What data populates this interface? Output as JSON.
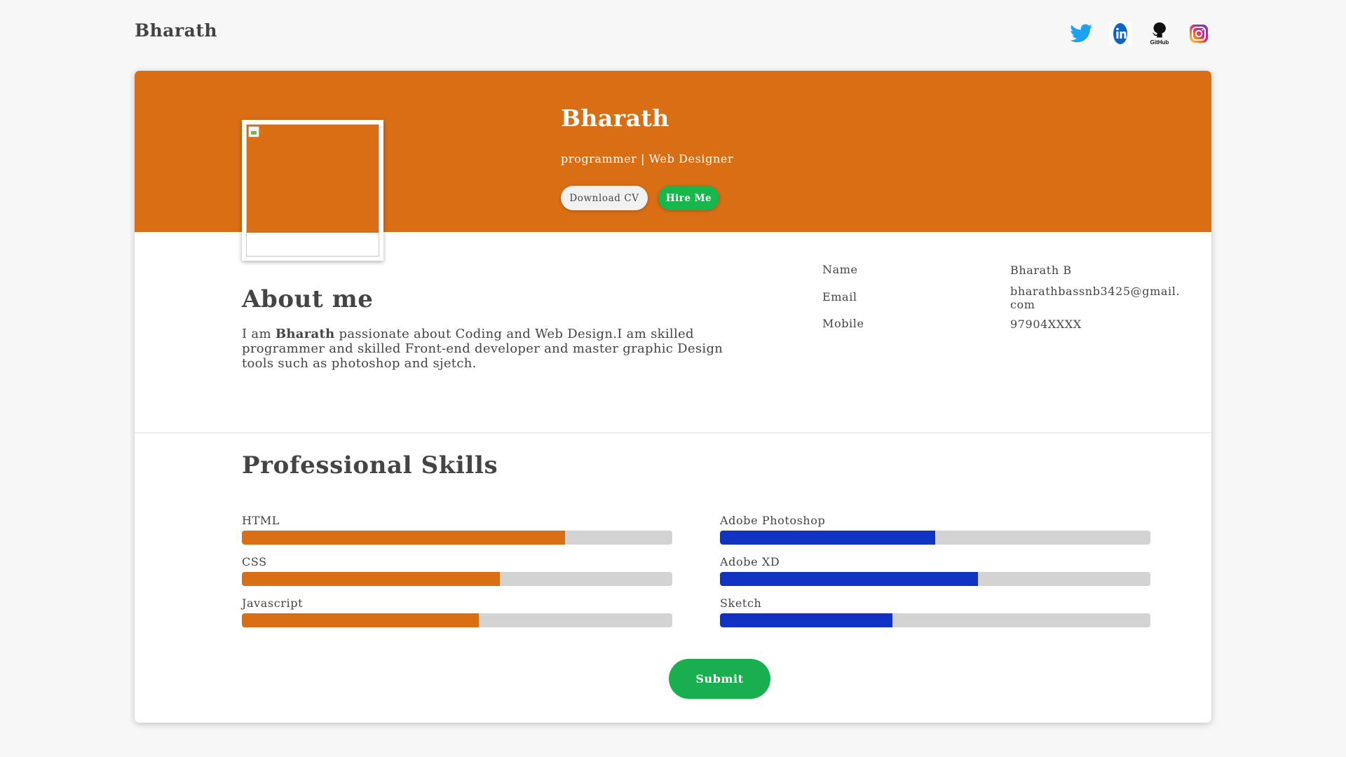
{
  "header": {
    "brand": "Bharath",
    "social": [
      {
        "name": "twitter-icon",
        "color": "#1da1f2"
      },
      {
        "name": "linkedin-icon",
        "color": "#0a66c2"
      },
      {
        "name": "github-icon",
        "color": "#111111",
        "caption": "GitHub"
      },
      {
        "name": "instagram-icon",
        "color": "#d62976"
      }
    ]
  },
  "hero": {
    "name": "Bharath",
    "role": "programmer | Web Designer",
    "download_label": "Download CV",
    "hire_label": "Hire Me",
    "accent": "#d96e15"
  },
  "about": {
    "title": "About me",
    "text_prefix": "I am ",
    "text_bold": "Bharath",
    "text_suffix": " passionate about Coding and Web Design.I am skilled programmer and skilled Front-end developer and master graphic Design tools such as photoshop and sjetch.",
    "info": [
      {
        "label": "Name",
        "value": "Bharath B"
      },
      {
        "label": "Email",
        "value": "bharathbassnb3425@gmail.com"
      },
      {
        "label": "Mobile",
        "value": "97904XXXX"
      }
    ]
  },
  "skills": {
    "title": "Professional Skills",
    "left": [
      {
        "label": "HTML",
        "percent": 75,
        "color": "#d96e15"
      },
      {
        "label": "CSS",
        "percent": 60,
        "color": "#d96e15"
      },
      {
        "label": "Javascript",
        "percent": 55,
        "color": "#d96e15"
      }
    ],
    "right": [
      {
        "label": "Adobe Photoshop",
        "percent": 50,
        "color": "#1133c4"
      },
      {
        "label": "Adobe XD",
        "percent": 60,
        "color": "#1133c4"
      },
      {
        "label": "Sketch",
        "percent": 40,
        "color": "#1133c4"
      }
    ]
  },
  "submit_label": "Submit"
}
